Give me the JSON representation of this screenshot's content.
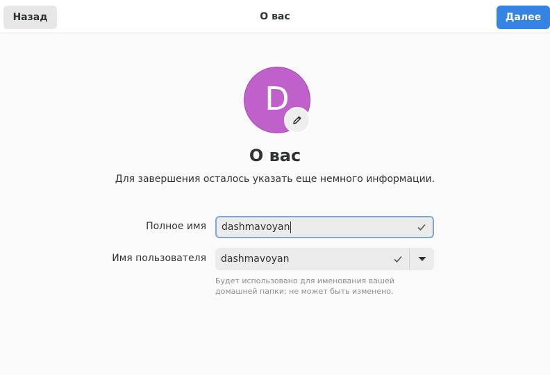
{
  "header": {
    "back_label": "Назад",
    "title": "О вас",
    "next_label": "Далее"
  },
  "avatar": {
    "letter": "D",
    "color": "#c061cb",
    "edit_icon": "pencil-icon"
  },
  "main": {
    "heading": "О вас",
    "subtitle": "Для завершения осталось указать еще немного информации."
  },
  "form": {
    "full_name": {
      "label": "Полное имя",
      "value": "dashmavoyan",
      "status_icon": "check-icon"
    },
    "username": {
      "label": "Имя пользователя",
      "value": "dashmavoyan",
      "status_icon": "check-icon",
      "dropdown_icon": "chevron-down-icon",
      "hint": "Будет использовано для именования вашей домашней папки; не может быть изменено."
    }
  },
  "colors": {
    "accent": "#3584e4",
    "background": "#fafafa"
  }
}
